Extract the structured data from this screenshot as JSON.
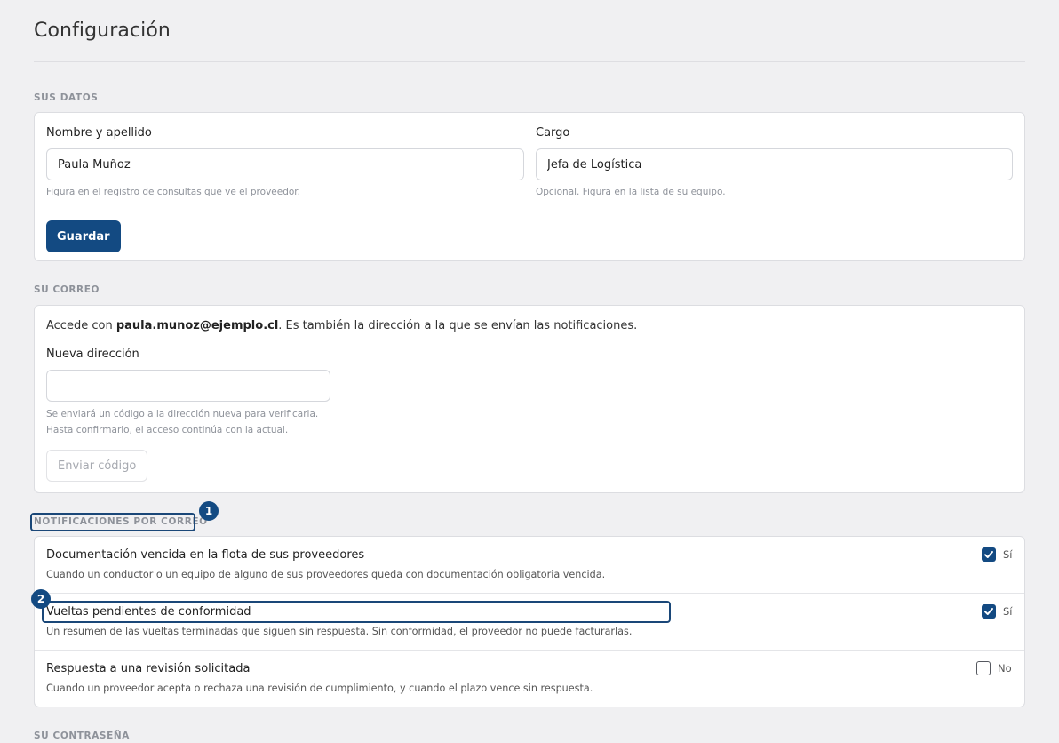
{
  "page": {
    "title": "Configuración"
  },
  "profile": {
    "section_label": "SUS DATOS",
    "name_label": "Nombre y apellido",
    "name_value": "Paula Muñoz",
    "name_hint": "Figura en el registro de consultas que ve el proveedor.",
    "role_label": "Cargo",
    "role_value": "Jefa de Logística",
    "role_hint": "Opcional. Figura en la lista de su equipo.",
    "save_label": "Guardar"
  },
  "email": {
    "section_label": "SU CORREO",
    "intro_prefix": "Accede con ",
    "current_email": "paula.munoz@ejemplo.cl",
    "intro_suffix": ". Es también la dirección a la que se envían las notificaciones.",
    "new_label": "Nueva dirección",
    "new_value": "",
    "hint_line1": "Se enviará un código a la dirección nueva para verificarla.",
    "hint_line2": "Hasta confirmarlo, el acceso continúa con la actual.",
    "send_label": "Enviar código"
  },
  "notifications": {
    "section_label": "NOTIFICACIONES POR CORREO",
    "items": [
      {
        "title": "Documentación vencida en la flota de sus proveedores",
        "description": "Cuando un conductor o un equipo de alguno de sus proveedores queda con documentación obligatoria vencida.",
        "checked": true,
        "state_label": "Sí"
      },
      {
        "title": "Vueltas pendientes de conformidad",
        "description": "Un resumen de las vueltas terminadas que siguen sin respuesta. Sin conformidad, el proveedor no puede facturarlas.",
        "checked": true,
        "state_label": "Sí"
      },
      {
        "title": "Respuesta a una revisión solicitada",
        "description": "Cuando un proveedor acepta o rechaza una revisión de cumplimiento, y cuando el plazo vence sin respuesta.",
        "checked": false,
        "state_label": "No"
      }
    ]
  },
  "password": {
    "section_label": "SU CONTRASEÑA"
  },
  "markers": [
    {
      "number": "1"
    },
    {
      "number": "2"
    }
  ],
  "colors": {
    "primary": "#134a82",
    "background": "#f0f0f2",
    "card": "#ffffff",
    "muted_text": "#8e929a"
  },
  "icons": {
    "checkmark": "check-icon"
  }
}
